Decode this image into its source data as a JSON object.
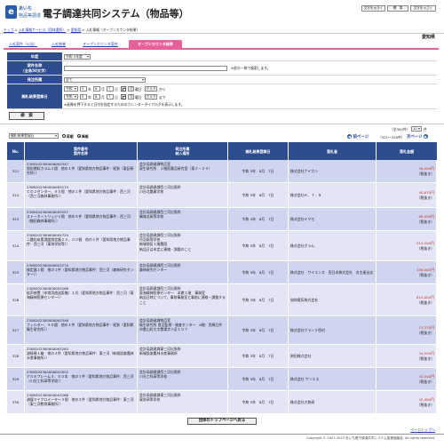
{
  "header": {
    "logo_mark": "e",
    "logo_line1": "あいち",
    "logo_line2": "物品等調達",
    "system_title": "電子調達共同システム（物品等）",
    "btn_font": "文字を大きく",
    "btn_standard": "標　準",
    "btn_font_small": "文字を小さく"
  },
  "breadcrumb": {
    "items": [
      "トップ",
      "入札情報サービス（団体選択）",
      "愛知県",
      "入札情報（オープンカウンタ結果）"
    ],
    "separator": " > "
  },
  "prefecture": "愛知県",
  "tabs": [
    {
      "label": "入札案件（公告）",
      "active": false
    },
    {
      "label": "入札結果",
      "active": false
    },
    {
      "label": "オープンカウンタ案件",
      "active": false
    },
    {
      "label": "オープンカウンタ結果",
      "active": true
    }
  ],
  "form": {
    "year_label": "年度",
    "year_value": "令和 5年度",
    "case_name_label": "案件名称",
    "case_name_sub": "（全角50文字）",
    "case_name_value": "",
    "case_name_hint": "※部分一致で検索します。",
    "bureau_label": "発注所属",
    "bureau_value": "全て",
    "date_label": "開札結果登録日",
    "era": "令和",
    "from_year": "5",
    "from_month": "8",
    "from_day": "7",
    "from_weekday": "月",
    "to_year": "5",
    "to_month": "8",
    "to_day": "7",
    "to_weekday": "月",
    "unit_year": "年",
    "unit_month": "月",
    "unit_day": "日",
    "weekday_suffix": "曜日",
    "clear_label": "クリア",
    "from_word": "から",
    "to_word": "まで",
    "date_hint": "※画像を押下すると日付を指定するためのカレンダーダイアログを表示します。",
    "search_button": "検　索"
  },
  "list_controls": {
    "sort_value": "開札結果登録日",
    "order_asc": "昇順",
    "order_desc": "降順",
    "order_selected": "desc",
    "total": "（全300件）",
    "per_page_value": "10",
    "per_page_unit": "件",
    "prev": "前ページ",
    "page_range": "（321～330件）",
    "next": "次ページ"
  },
  "table": {
    "headers": {
      "no": "No.",
      "case": [
        "案件番号",
        "案件名称"
      ],
      "bureau": [
        "発注所属",
        "納入場所"
      ],
      "date": "開札結果登録日",
      "winner": "落札者",
      "amount": "落札金額"
    },
    "rows": [
      {
        "no": "321",
        "case_no": "2308202300000003347",
        "case_name": "固形燃料カラム２個　他の１件（愛知県地方物品事件：尾張（東記研究所））",
        "bureau": "会計局調達課物品室",
        "place": "東生研究所　２階医薬品研究室（東２－２９）",
        "date": "令和 5年　8月　7日",
        "winner": "株式会社ナイカン",
        "amount": "56,000円",
        "tax": "（税抜き）"
      },
      {
        "no": "322",
        "case_no": "2308202300000003174",
        "case_name": "ＣＯ２センター、９０個　他の１件（愛知県地方物品事件：西三河（西三河森林事務所））",
        "bureau": "会計局調達課西三河出張所",
        "place": "川谷北農業学校",
        "date": "令和 5年　8月　7日",
        "winner": "株式会社Ｋ．Ｔ．Ｓ",
        "amount": "40,670円",
        "tax": "（税抜き）"
      },
      {
        "no": "323",
        "case_no": "2308202300000003257",
        "case_name": "ストーカートリッジ１個　他の５件（愛知県地方物品事件：西三河（額田森林事務所））",
        "bureau": "会計局調達課西三河出張所",
        "place": "鶴城北高等学校",
        "date": "令和 5年　8月　7日",
        "winner": "株式会社イクモ",
        "amount": "66,000円",
        "tax": "（税抜き）"
      },
      {
        "no": "324",
        "case_no": "2308202300000002724",
        "case_name": "二酸化炭素濃度測定器２２、００個　他の１件（愛知県地方物品事件：西三河（東海学校等））",
        "bureau": "会計局調達課西三河出張所",
        "place": "丹羽高等学校\n新城地区１階農園\n納品日は未定に連絡・調整のこと",
        "date": "令和 5年　8月　7日",
        "winner": "株式会社ボラム",
        "amount": "214,500円",
        "tax": "（税抜き）"
      },
      {
        "no": "325",
        "case_no": "2308202300000003270",
        "case_name": "検定器１個　他の１件（愛知県地方物品事件：西三河（森林研究センター））",
        "bureau": "会計局調達課西三河出張所",
        "place": "森林研究センター",
        "date": "令和 5年　8月　7日",
        "winner": "株式会社　サイエンス　西日本株式会社　名古屋支店",
        "amount": "456,000円",
        "tax": "（税抜き）"
      },
      {
        "no": "326",
        "case_no": "2308202300000003268",
        "case_name": "拡声装置（非常用放送設備）１式（愛知県地方物品事件：西三河（東海精神医療センター））",
        "bureau": "会計局調達課西三河出張所",
        "place": "東海精神医療センター　本館１階　事務室\n納品日時について、事前事務室と事前に連絡・調整すること",
        "date": "令和 5年　8月　7日",
        "winner": "協和電気株式会社",
        "amount": "810,000円",
        "tax": "（税抜き）"
      },
      {
        "no": "327",
        "case_no": "2308202300000003346",
        "case_name": "フィルター、９０個　他の１件（愛知県地方物品事件：尾張（愛知県衛生研究所））",
        "bureau": "会計局調達課物品室",
        "place": "衛生研究所 食品監視・検査センター　6階：西棟日井市豊山町大字豊場字八反１０７",
        "date": "令和 5年　8月　7日",
        "winner": "株式会社クランテ西村",
        "amount": "23,370円",
        "tax": "（税抜き）"
      },
      {
        "no": "328",
        "case_no": "2308202300000003263",
        "case_name": "溶接棒１箱　他の４件（愛知県地方物品事件：東三河（新城設楽農林水産事務所））",
        "bureau": "会計局調達課東三河出張所",
        "place": "新城設楽農林水産事務所",
        "date": "令和 5年　8月　7日",
        "winner": "原田株式会社",
        "amount": "34,500円",
        "tax": "（税抜き）"
      },
      {
        "no": "329",
        "case_no": "2308202300000003052",
        "case_name": "アルミフレーム３、００本　他の１件（愛知県地方物品事件：西三河（川谷工科高等学校））",
        "bureau": "会計局調達課西三河出張所",
        "place": "川谷工科高等学校",
        "date": "令和 5年　8月　7日",
        "winner": "株式会社 サンエス",
        "amount": "42,340円",
        "tax": "（税抜き）"
      },
      {
        "no": "330",
        "case_no": "2308202300000003266",
        "case_name": "溶媒マイクロメーター３個　他の２件（愛知県地方物品事件：東三河（東三河教育事務所））",
        "bureau": "会計局調達課東三河出張所",
        "place": "東栄高等学校",
        "date": "令和 5年　8月　7日",
        "winner": "株式会社大和研",
        "amount": "42,480円",
        "tax": "（税抜き）"
      }
    ]
  },
  "footer": {
    "back_button": "団体のトップページへ戻る",
    "page_top": "ページトップへ",
    "copyright": "Copyright © 2007-2023 あいち電子調達共同システム推進協議会. All rights reserved."
  }
}
